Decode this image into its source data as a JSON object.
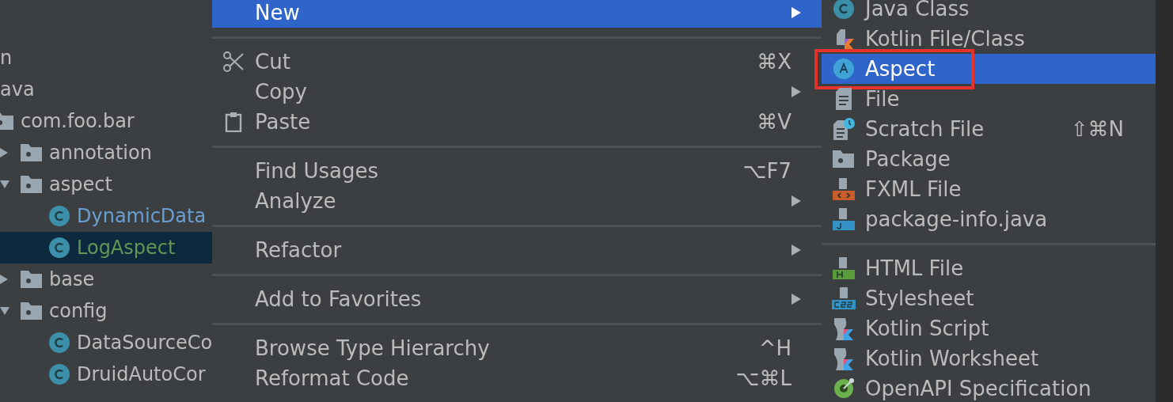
{
  "project_tree": [
    {
      "label": "n",
      "kind": "text",
      "selected": false,
      "color": "#bbbbbb"
    },
    {
      "label": "ava",
      "kind": "text",
      "selected": false,
      "color": "#bbbbbb",
      "children": [
        {
          "label": "com.foo.bar",
          "kind": "folder",
          "selected": false,
          "color": "#bbbbbb",
          "children": [
            {
              "label": "annotation",
              "kind": "folder",
              "expanded": false,
              "selected": false,
              "color": "#bbbbbb"
            },
            {
              "label": "aspect",
              "kind": "folder",
              "expanded": true,
              "selected": false,
              "color": "#bbbbbb",
              "children": [
                {
                  "label": "DynamicData",
                  "kind": "class",
                  "selected": false,
                  "color": "#6a9fd4"
                },
                {
                  "label": "LogAspect",
                  "kind": "class",
                  "selected": true,
                  "color": "#629755"
                }
              ]
            },
            {
              "label": "base",
              "kind": "folder",
              "expanded": false,
              "selected": false,
              "color": "#bbbbbb"
            },
            {
              "label": "config",
              "kind": "folder",
              "expanded": true,
              "selected": false,
              "color": "#bbbbbb",
              "children": [
                {
                  "label": "DataSourceCo",
                  "kind": "class",
                  "selected": false,
                  "color": "#bbbbbb"
                },
                {
                  "label": "DruidAutoCor",
                  "kind": "class",
                  "selected": false,
                  "color": "#bbbbbb"
                }
              ]
            }
          ]
        }
      ]
    }
  ],
  "context_menu": [
    [
      {
        "label": "New",
        "submenu": true,
        "selected": true
      }
    ],
    [
      {
        "label": "Cut",
        "kind": "scissors",
        "shortcut": "⌘X",
        "submenu": false,
        "selected": false
      },
      {
        "label": "Copy",
        "submenu": true,
        "selected": false
      },
      {
        "label": "Paste",
        "kind": "clipboard",
        "shortcut": "⌘V",
        "submenu": false,
        "selected": false
      }
    ],
    [
      {
        "label": "Find Usages",
        "shortcut": "⌥F7",
        "submenu": false,
        "selected": false
      },
      {
        "label": "Analyze",
        "submenu": true,
        "selected": false
      }
    ],
    [
      {
        "label": "Refactor",
        "submenu": true,
        "selected": false
      }
    ],
    [
      {
        "label": "Add to Favorites",
        "submenu": true,
        "selected": false
      }
    ],
    [
      {
        "label": "Browse Type Hierarchy",
        "shortcut": "^H",
        "submenu": false,
        "selected": false
      },
      {
        "label": "Reformat Code",
        "shortcut": "⌥⌘L",
        "submenu": false,
        "selected": false
      }
    ]
  ],
  "new_submenu": [
    [
      {
        "label": "Java Class",
        "kind": "class",
        "selected": false,
        "framed": false
      },
      {
        "label": "Kotlin File/Class",
        "kind": "kotlin-file",
        "selected": false,
        "framed": false
      },
      {
        "label": "Aspect",
        "kind": "aspect",
        "selected": true,
        "framed": true
      },
      {
        "label": "File",
        "kind": "file",
        "selected": false,
        "framed": false
      },
      {
        "label": "Scratch File",
        "kind": "scratch",
        "shortcut": "⇧⌘N",
        "selected": false,
        "framed": false
      },
      {
        "label": "Package",
        "kind": "folder",
        "selected": false,
        "framed": false
      },
      {
        "label": "FXML File",
        "kind": "fxml",
        "selected": false,
        "framed": false
      },
      {
        "label": "package-info.java",
        "kind": "java-file",
        "selected": false,
        "framed": false
      }
    ],
    [
      {
        "label": "HTML File",
        "kind": "html",
        "selected": false,
        "framed": false
      },
      {
        "label": "Stylesheet",
        "kind": "css",
        "selected": false,
        "framed": false
      },
      {
        "label": "Kotlin Script",
        "kind": "kotlin-script",
        "selected": false,
        "framed": false
      },
      {
        "label": "Kotlin Worksheet",
        "kind": "kotlin-script",
        "selected": false,
        "framed": false
      },
      {
        "label": "OpenAPI Specification",
        "kind": "openapi",
        "selected": false,
        "framed": false
      }
    ]
  ]
}
